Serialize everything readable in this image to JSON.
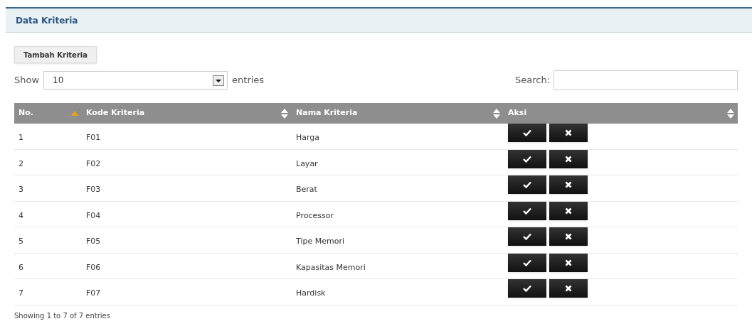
{
  "panel": {
    "title": "Data Kriteria"
  },
  "add_button": "Tambah Kriteria",
  "length": {
    "label_before": "Show",
    "value": "10",
    "label_after": "entries"
  },
  "search": {
    "label": "Search:"
  },
  "table": {
    "columns": [
      {
        "label": "No.",
        "sorted": true
      },
      {
        "label": "Kode Kriteria",
        "sorted": false
      },
      {
        "label": "Nama Kriteria",
        "sorted": false
      },
      {
        "label": "Aksi",
        "sorted": false
      }
    ],
    "rows": [
      {
        "no": "1",
        "kode": "F01",
        "nama": "Harga"
      },
      {
        "no": "2",
        "kode": "F02",
        "nama": "Layar"
      },
      {
        "no": "3",
        "kode": "F03",
        "nama": "Berat"
      },
      {
        "no": "4",
        "kode": "F04",
        "nama": "Processor"
      },
      {
        "no": "5",
        "kode": "F05",
        "nama": "Tipe Memori"
      },
      {
        "no": "6",
        "kode": "F06",
        "nama": "Kapasitas Memori"
      },
      {
        "no": "7",
        "kode": "F07",
        "nama": "Hardisk"
      }
    ]
  },
  "info": "Showing 1 to 7 of 7 entries"
}
